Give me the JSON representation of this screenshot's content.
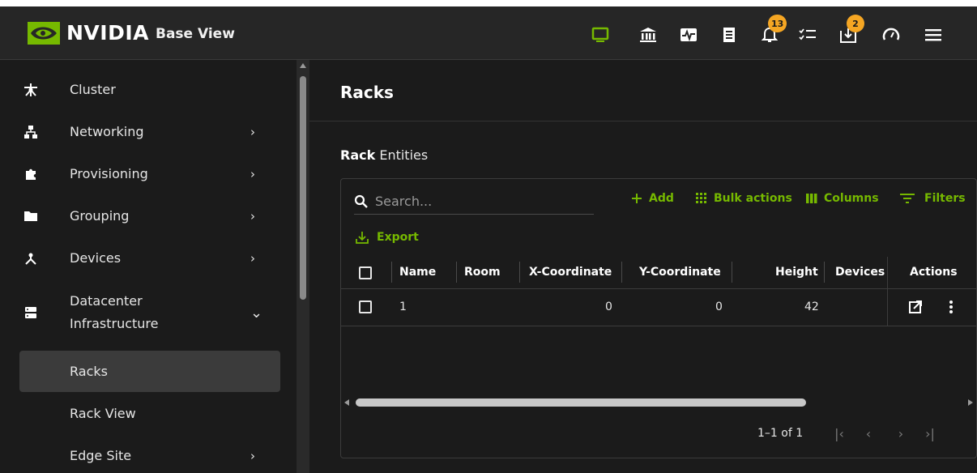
{
  "header": {
    "brand": "NVIDIA",
    "product": "Base View",
    "icons": [
      {
        "name": "monitor-icon",
        "color": "#76b900"
      },
      {
        "name": "bank-icon"
      },
      {
        "name": "health-icon"
      },
      {
        "name": "document-icon"
      },
      {
        "name": "notifications-icon",
        "badge": "13"
      },
      {
        "name": "tasks-icon"
      },
      {
        "name": "downloads-icon",
        "badge": "2"
      },
      {
        "name": "speedometer-icon"
      },
      {
        "name": "menu-icon"
      }
    ]
  },
  "sidebar": {
    "items": [
      {
        "label": "Cluster",
        "icon": "cluster-icon"
      },
      {
        "label": "Networking",
        "icon": "network-icon",
        "chevron": "›"
      },
      {
        "label": "Provisioning",
        "icon": "puzzle-icon",
        "chevron": "›"
      },
      {
        "label": "Grouping",
        "icon": "folder-icon",
        "chevron": "›"
      },
      {
        "label": "Devices",
        "icon": "devices-icon",
        "chevron": "›"
      },
      {
        "label_line1": "Datacenter",
        "label_line2": "Infrastructure",
        "icon": "server-icon",
        "chevron": "⌄"
      },
      {
        "label": "Racks",
        "active": true
      },
      {
        "label": "Rack View"
      },
      {
        "label": "Edge Site",
        "chevron": "›"
      }
    ]
  },
  "main": {
    "title": "Racks",
    "section_bold": "Rack",
    "section_rest": " Entities",
    "search_placeholder": "Search...",
    "toolbar": {
      "add": "Add",
      "bulk": "Bulk actions",
      "columns": "Columns",
      "filters": "Filters",
      "export": "Export"
    },
    "columns": [
      "Name",
      "Room",
      "X-Coordinate",
      "Y-Coordinate",
      "Height",
      "Devices",
      "Actions"
    ],
    "rows": [
      {
        "name": "1",
        "room": "",
        "x": "0",
        "y": "0",
        "height": "42",
        "devices": ""
      }
    ],
    "pagination": {
      "range": "1–1 of 1"
    }
  },
  "colors": {
    "accent": "#76b900",
    "badge": "#f5a623"
  }
}
